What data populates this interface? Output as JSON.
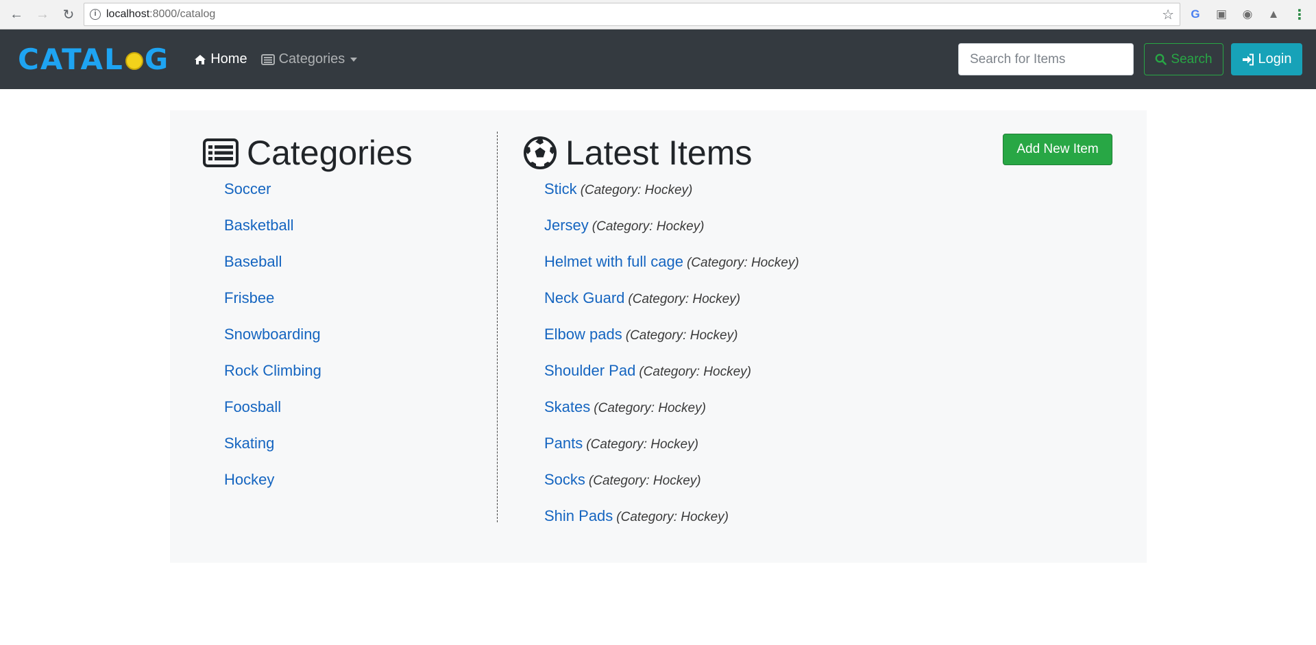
{
  "browser": {
    "url_host": "localhost",
    "url_path": ":8000/catalog"
  },
  "navbar": {
    "logo_left": "CATAL",
    "logo_right": "G",
    "home_label": "Home",
    "categories_label": "Categories",
    "search_placeholder": "Search for Items",
    "search_button_label": "Search",
    "login_button_label": "Login"
  },
  "categories": {
    "heading": "Categories",
    "items": [
      "Soccer",
      "Basketball",
      "Baseball",
      "Frisbee",
      "Snowboarding",
      "Rock Climbing",
      "Foosball",
      "Skating",
      "Hockey"
    ]
  },
  "latest": {
    "heading": "Latest Items",
    "add_button_label": "Add New Item",
    "items": [
      {
        "name": "Stick",
        "category": "(Category: Hockey)"
      },
      {
        "name": "Jersey",
        "category": "(Category: Hockey)"
      },
      {
        "name": "Helmet with full cage",
        "category": "(Category: Hockey)"
      },
      {
        "name": "Neck Guard",
        "category": "(Category: Hockey)"
      },
      {
        "name": "Elbow pads",
        "category": "(Category: Hockey)"
      },
      {
        "name": "Shoulder Pad",
        "category": "(Category: Hockey)"
      },
      {
        "name": "Skates",
        "category": "(Category: Hockey)"
      },
      {
        "name": "Pants",
        "category": "(Category: Hockey)"
      },
      {
        "name": "Socks",
        "category": "(Category: Hockey)"
      },
      {
        "name": "Shin Pads",
        "category": "(Category: Hockey)"
      }
    ]
  },
  "colors": {
    "navbar_bg": "#343a40",
    "link": "#1565c0",
    "success": "#28a745",
    "info": "#17a2b8"
  }
}
